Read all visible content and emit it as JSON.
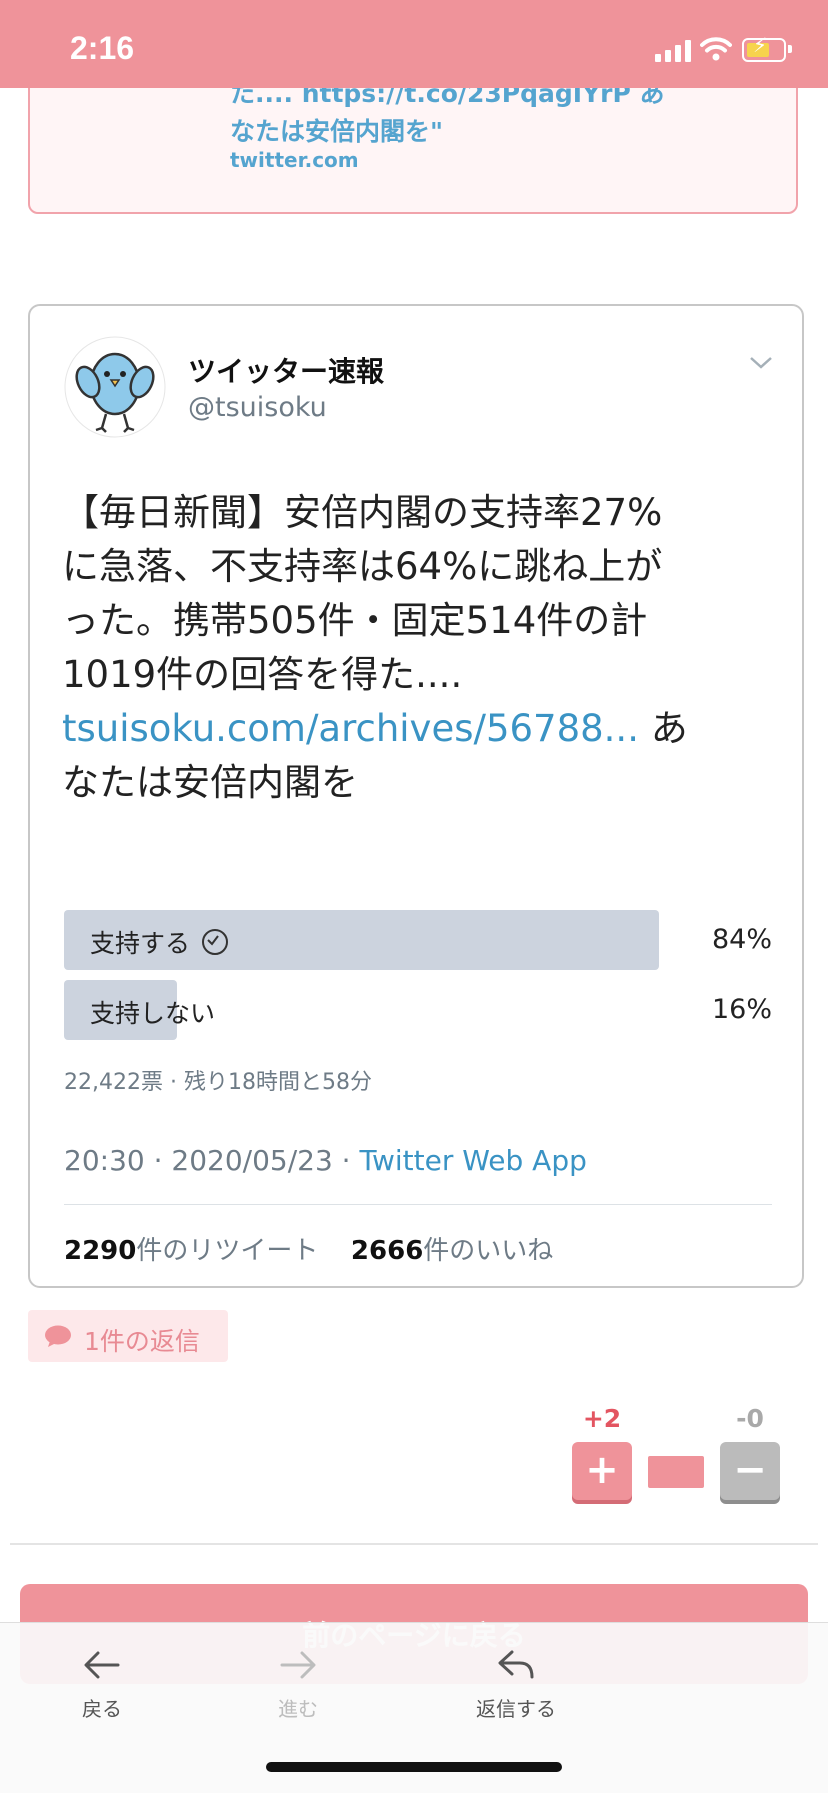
{
  "status_bar": {
    "time": "2:16"
  },
  "previous_card": {
    "link_line1": "た.... https://t.co/23PqagIYrP あ",
    "link_line2": "なたは安倍内閣を\"",
    "domain": "twitter.com"
  },
  "tweet": {
    "author_name": "ツイッター速報",
    "author_handle": "@tsuisoku",
    "body_line1": "【毎日新聞】安倍内閣の支持率27%",
    "body_line2": "に急落、不支持率は64%に跳ね上が",
    "body_line3": "った。携帯505件・固定514件の計",
    "body_line4": "1019件の回答を得た....",
    "body_link": "tsuisoku.com/archives/56788...",
    "body_link_after": " あ",
    "body_line6": "なたは安倍内閣を",
    "poll": {
      "options": [
        {
          "label": "支持する",
          "percent": "84%",
          "share": 0.84,
          "selected": true
        },
        {
          "label": "支持しない",
          "percent": "16%",
          "share": 0.16,
          "selected": false
        }
      ],
      "meta": "22,422票 · 残り18時間と58分"
    },
    "time_date": "20:30 · 2020/05/23 · ",
    "source_app": "Twitter Web App",
    "retweets_count": "2290",
    "retweets_label": "件のリツイート",
    "likes_count": "2666",
    "likes_label": "件のいいね"
  },
  "replies": {
    "label": "1件の返信"
  },
  "votes": {
    "plus_count": "+2",
    "minus_count": "-0",
    "plus_symbol": "+",
    "minus_symbol": "−"
  },
  "back_to_previous": "前のページに戻る",
  "bottom_nav": [
    {
      "label": "戻る",
      "icon": "arrow-left-icon"
    },
    {
      "label": "進む",
      "icon": "arrow-right-icon"
    },
    {
      "label": "返信する",
      "icon": "reply-icon"
    }
  ],
  "colors": {
    "accent": "#ef939a",
    "link": "#3a93c4",
    "poll_bar": "#ccd3de"
  }
}
